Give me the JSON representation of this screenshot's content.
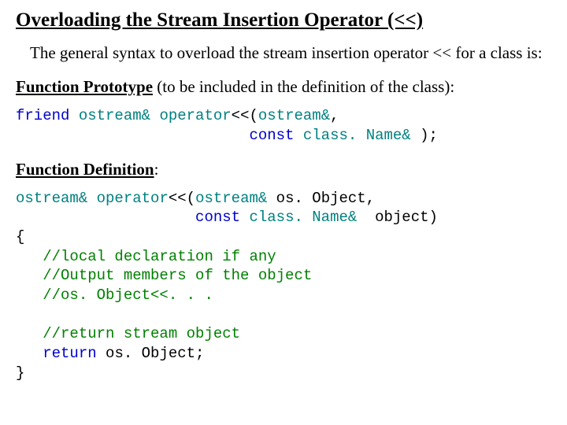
{
  "title": "Overloading the Stream Insertion Operator (<<)",
  "intro": "The general syntax to overload the stream insertion operator << for a class is:",
  "prototype": {
    "label": "Function Prototype",
    "note": " (to be included in the definition of the class):",
    "code": {
      "friend": "friend ",
      "ostream": "ostream& ",
      "operatorTok": "operator",
      "afterOp1": "<<(",
      "ostream2": "ostream&",
      "comma1": ",",
      "indent2": "                          ",
      "const": "const ",
      "className": "class. Name&",
      "tail": " );"
    }
  },
  "definition": {
    "label": "Function Definition",
    "colon": ":",
    "code": {
      "ostream": "ostream& ",
      "operatorTok": "operator",
      "afterOp1": "<<(",
      "ostream2": "ostream&",
      "os1": " os. Object,",
      "indent2": "                    ",
      "const": "const ",
      "className": "class. Name&",
      "obj": "  object)",
      "brace1": "{",
      "cmt1": "   //local declaration if any",
      "cmt2": "   //Output members of the object",
      "cmt3": "   //os. Object<<. . .",
      "blank": "",
      "cmt4": "   //return stream object",
      "retIndent": "   ",
      "return": "return",
      "retTail": " os. Object;",
      "brace2": "}"
    }
  }
}
